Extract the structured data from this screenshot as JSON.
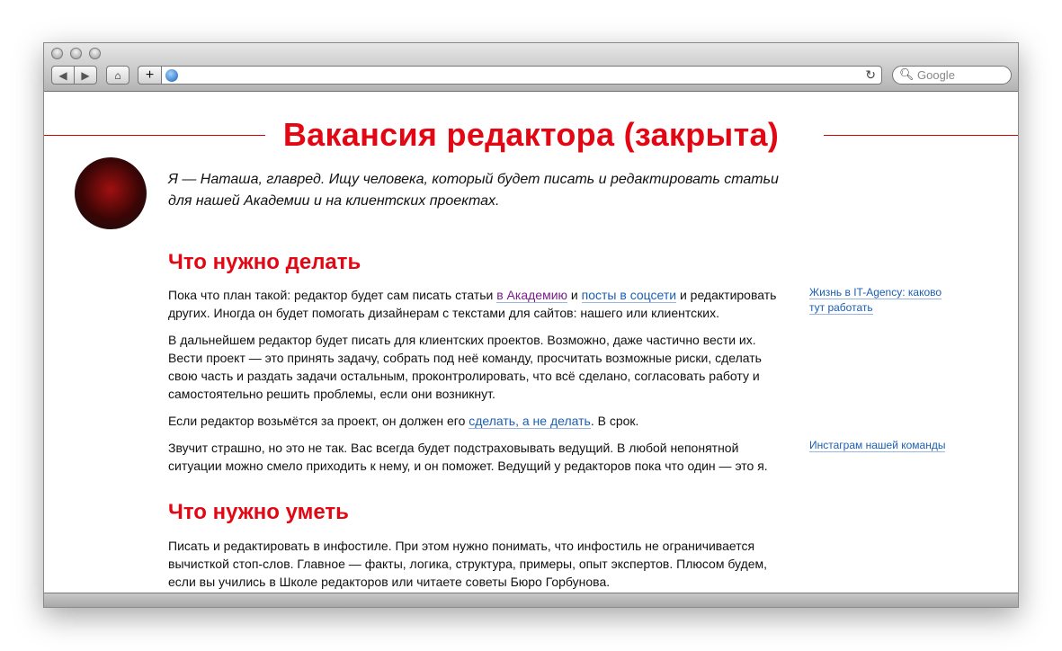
{
  "browser": {
    "search_placeholder": "Google",
    "url": ""
  },
  "page": {
    "title": "Вакансия редактора (закрыта)",
    "lead": "Я — Наташа, главред. Ищу человека, который будет писать и редактировать статьи для нашей Академии и на клиентских проектах.",
    "s1": {
      "heading": "Что нужно делать",
      "p1a": "Пока что план такой: редактор будет сам писать статьи ",
      "p1link1": "в Академию",
      "p1b": " и ",
      "p1link2": "посты в соцсети",
      "p1c": " и редактировать других. Иногда он будет помогать дизайнерам с текстами для сайтов: нашего или клиентских.",
      "p2": "В дальнейшем редактор будет писать для клиентских проектов. Возможно, даже частично вести их. Вести проект — это принять задачу, собрать под неё команду, просчитать возможные риски, сделать свою часть и раздать задачи остальным, проконтролировать, что всё сделано, согласовать работу и самостоятельно решить проблемы, если они возникнут.",
      "p3a": "Если редактор возьмётся за проект, он должен его ",
      "p3link": "сделать, а не делать",
      "p3b": ". В срок.",
      "p4": "Звучит страшно, но это не так. Вас всегда будет подстраховывать ведущий. В любой непонятной ситуации можно смело приходить к нему, и он поможет. Ведущий у редакторов пока что один — это я."
    },
    "s2": {
      "heading": "Что нужно уметь",
      "p1": "Писать и редактировать в инфостиле. При этом нужно понимать, что инфостиль не ограничивается вычисткой стоп-слов. Главное — факты, логика, структура, примеры, опыт экспертов. Плюсом будем, если вы учились в Школе редакторов или читаете советы Бюро Горбунова."
    },
    "side1": "Жизнь в IT-Agency: каково тут работать",
    "side2": "Инстаграм нашей команды"
  }
}
